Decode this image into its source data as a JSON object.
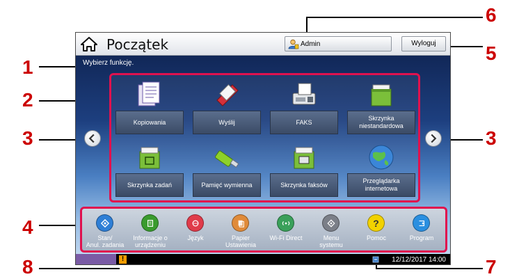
{
  "callouts": {
    "c1": "1",
    "c2": "2",
    "c3_left": "3",
    "c3_right": "3",
    "c4": "4",
    "c5": "5",
    "c6": "6",
    "c7": "7",
    "c8": "8"
  },
  "header": {
    "title": "Początek",
    "home_icon": "home-icon",
    "admin_label": "Admin",
    "logout_label": "Wyloguj"
  },
  "message": "Wybierz funkcję.",
  "apps": [
    {
      "label": "Kopiowania",
      "icon": "copy-icon"
    },
    {
      "label": "Wyślij",
      "icon": "send-icon"
    },
    {
      "label": "FAKS",
      "icon": "fax-icon"
    },
    {
      "label": "Skrzynka niestandardowa",
      "icon": "custom-box-icon"
    },
    {
      "label": "Skrzynka zadań",
      "icon": "job-box-icon"
    },
    {
      "label": "Pamięć wymienna",
      "icon": "usb-memory-icon"
    },
    {
      "label": "Skrzynka faksów",
      "icon": "fax-box-icon"
    },
    {
      "label": "Przeglądarka internetowa",
      "icon": "globe-icon"
    }
  ],
  "dock": [
    {
      "label": "Stan/\nAnul. zadania",
      "color": "#2f7fd6"
    },
    {
      "label": "Informacje o\nurządzeniu",
      "color": "#3a9b2e"
    },
    {
      "label": "Język",
      "color": "#e03b4a"
    },
    {
      "label": "Papier\nUstawienia",
      "color": "#e08b3a"
    },
    {
      "label": "Wi-Fi Direct",
      "color": "#3aa05a"
    },
    {
      "label": "Menu\nsystemu",
      "color": "#7b7f88"
    },
    {
      "label": "Pomoc",
      "color": "#f2d200"
    },
    {
      "label": "Program",
      "color": "#2b8fe0"
    }
  ],
  "status": {
    "datetime": "12/12/2017 14:00",
    "accent_color": "#7a5ba5",
    "warning_color": "#f39c00"
  },
  "colors": {
    "highlight": "#e0114e",
    "callout_number": "#cc0000"
  }
}
